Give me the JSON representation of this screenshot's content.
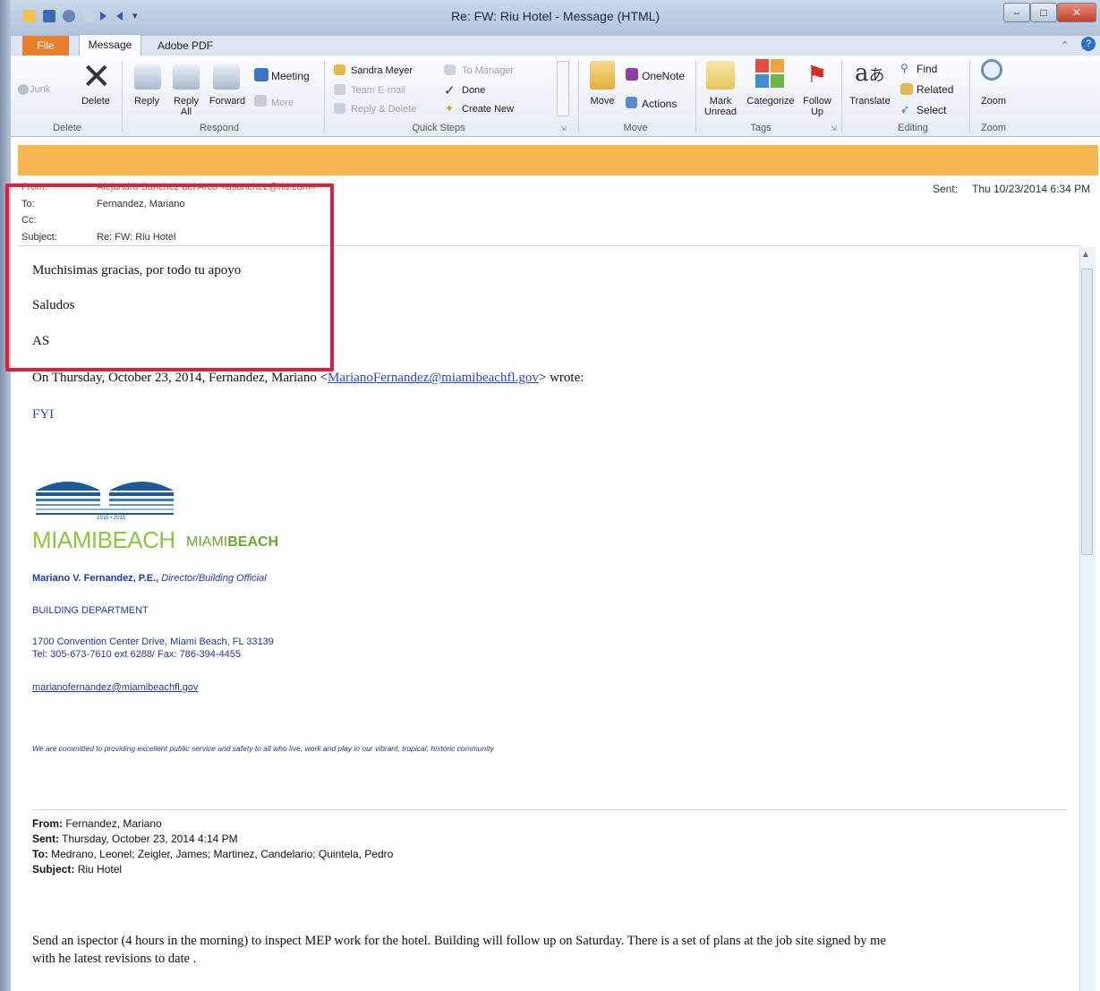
{
  "window": {
    "title": "Re: FW: Riu Hotel  -  Message (HTML)"
  },
  "tabs": {
    "file": "File",
    "message": "Message",
    "adobe": "Adobe PDF"
  },
  "ribbon": {
    "delete_group": {
      "junk": "Junk",
      "delete": "Delete",
      "label": "Delete"
    },
    "respond_group": {
      "reply": "Reply",
      "reply_all_1": "Reply",
      "reply_all_2": "All",
      "forward": "Forward",
      "meeting": "Meeting",
      "more": "More",
      "label": "Respond"
    },
    "quick_steps": {
      "items": [
        "Sandra Meyer",
        "Team E-mail",
        "Reply & Delete",
        "To Manager",
        "Done",
        "Create New"
      ],
      "label": "Quick Steps"
    },
    "move_group": {
      "move": "Move",
      "onenote": "OneNote",
      "actions": "Actions",
      "label": "Move"
    },
    "tags_group": {
      "mark_unread_1": "Mark",
      "mark_unread_2": "Unread",
      "categorize": "Categorize",
      "follow_up_1": "Follow",
      "follow_up_2": "Up",
      "label": "Tags"
    },
    "editing_group": {
      "translate": "Translate",
      "find": "Find",
      "related": "Related",
      "select": "Select",
      "label": "Editing"
    },
    "zoom_group": {
      "zoom": "Zoom",
      "label": "Zoom"
    }
  },
  "header": {
    "from_label": "From:",
    "from_value": "Alejandro Sanchez del Arco <asanchez@rid.com>",
    "to_label": "To:",
    "to_value": "Fernandez, Mariano",
    "cc_label": "Cc:",
    "subject_label": "Subject:",
    "subject_value": "Re: FW: Riu Hotel",
    "sent_label": "Sent:",
    "sent_value": "Thu 10/23/2014 6:34 PM"
  },
  "body": {
    "line1": "Muchisimas gracias, por todo tu apoyo",
    "line2": "Saludos",
    "line3": "AS",
    "wrote_pre": "On Thursday, October 23, 2014, Fernandez, Mariano <",
    "wrote_email": "MarianoFernandez@miamibeachfl.gov",
    "wrote_post": "> wrote:",
    "fyi": "FYI"
  },
  "signature": {
    "logo_years": "1915 • 2015",
    "logo_text": "MIAMIBEACH",
    "logo_text2_a": "MIAMI",
    "logo_text2_b": "BEACH",
    "name": "Mariano V. Fernandez, P.E.,",
    "title": "Director/Building Official",
    "dept": "BUILDING DEPARTMENT",
    "address": "1700 Convention Center Drive, Miami Beach, FL 33139",
    "tel": "Tel: 305-673-7610 ext 6288/ Fax: 786-394-4455",
    "email": "marianofernandez@miamibeachfl.gov",
    "motto": "We are committed to providing excellent public service and safety to all who live, work and play in our vibrant, tropical, historic community"
  },
  "forwarded": {
    "from_label": "From:",
    "from_value": "Fernandez, Mariano",
    "sent_label": "Sent:",
    "sent_value": "Thursday, October 23, 2014 4:14 PM",
    "to_label": "To:",
    "to_value": "Medrano, Leonel; Zeigler, James; Martinez, Candelario; Quintela, Pedro",
    "subject_label": "Subject:",
    "subject_value": "Riu Hotel",
    "text_line1": "Send an ispector (4 hours in the morning) to inspect MEP work for the hotel. Building will follow up on Saturday. There is a set of plans at the job site signed by me",
    "text_line2": "with he latest revisions to date ."
  },
  "colors": {
    "accent_orange": "#f6b74f",
    "highlight_red": "#e0203a",
    "link_blue": "#2f4bb3",
    "file_tab": "#e8802b"
  }
}
